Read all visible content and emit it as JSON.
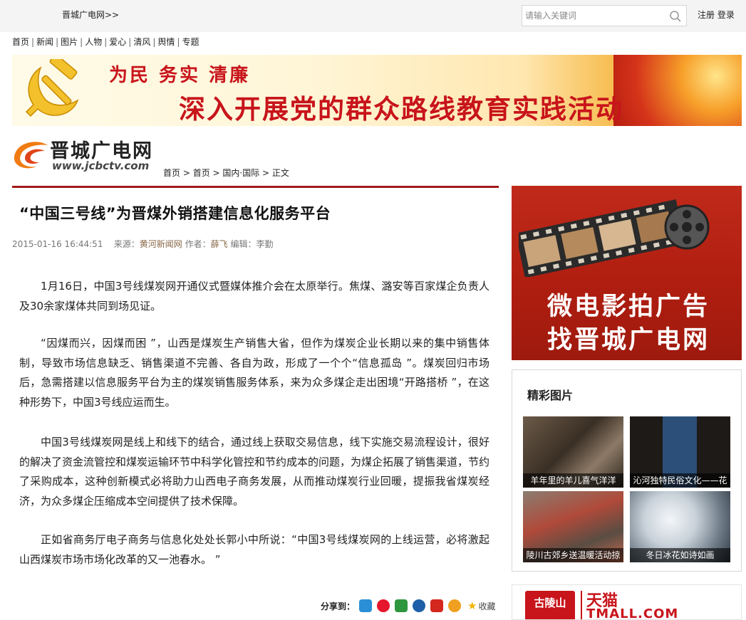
{
  "topbar": {
    "site_link": "晋城广电网>>",
    "search_placeholder": "请输入关键词",
    "register": "注册",
    "login": "登录"
  },
  "nav": {
    "items": [
      "首页",
      "新闻",
      "图片",
      "人物",
      "爱心",
      "清风",
      "舆情",
      "专题"
    ]
  },
  "banner": {
    "line1": "为民 务实 清廉",
    "line2": "深入开展党的群众路线教育实践活动"
  },
  "logo": {
    "name": "晋城广电网",
    "url": "www.jcbctv.com"
  },
  "breadcrumb": [
    "首页",
    "首页",
    "国内·国际",
    "正文"
  ],
  "article": {
    "title": "“中国三号线”为晋煤外销搭建信息化服务平台",
    "meta_datetime": "2015-01-16 16:44:51",
    "meta_source_label": "来源：",
    "meta_source": "黄河新闻网",
    "meta_author_label": "作者：",
    "meta_author": "薛飞",
    "meta_editor_label": "编辑：",
    "meta_editor": "李勤",
    "paragraphs": [
      "1月16日，中国3号线煤炭网开通仪式暨媒体推介会在太原举行。焦煤、潞安等百家煤企负责人及30余家煤体共同到场见证。",
      "“因煤而兴，因煤而困 ”，山西是煤炭生产销售大省，但作为煤炭企业长期以来的集中销售体制，导致市场信息缺乏、销售渠道不完善、各自为政，形成了一个个“信息孤岛 ”。煤炭回归市场后，急需搭建以信息服务平台为主的煤炭销售服务体系，来为众多煤企走出困境“开路搭桥 ”，在这种形势下，中国3号线应运而生。",
      "中国3号线煤炭网是线上和线下的结合，通过线上获取交易信息，线下实施交易流程设计，很好的解决了资金流管控和煤炭运输环节中科学化管控和节约成本的问题，为煤企拓展了销售渠道，节约了采购成本，这种创新模式必将助力山西电子商务发展，从而推动煤炭行业回暖，提振我省煤炭经济，为众多煤企压缩成本空间提供了技术保障。",
      "正如省商务厅电子商务与信息化处处长郭小中所说：“中国3号线煤炭网的上线运营，必将激起山西煤炭市场市场化改革的又一池春水。 ”"
    ]
  },
  "share": {
    "label": "分享到：",
    "fav_label": "收藏",
    "buttons": [
      {
        "icon": "qzone-icon",
        "color": "#2a8fd6"
      },
      {
        "icon": "weibo-icon",
        "color": "#e6162d"
      },
      {
        "icon": "douban-icon",
        "color": "#2e963d"
      },
      {
        "icon": "renren-icon",
        "color": "#1e5fa8"
      },
      {
        "icon": "people-icon",
        "color": "#d4271d"
      },
      {
        "icon": "kaixin-icon",
        "color": "#f0a020"
      }
    ]
  },
  "side_ad": {
    "line1": "微电影拍广告",
    "line2": "找晋城广电网"
  },
  "photo_box": {
    "title": "精彩图片",
    "items": [
      {
        "caption": "羊年里的羊儿喜气洋洋"
      },
      {
        "caption": "沁河独特民俗文化——花"
      },
      {
        "caption": "陵川古郊乡送温暖活动掠"
      },
      {
        "caption": "冬日冰花如诗如画"
      }
    ]
  },
  "bottom_ad": {
    "brand1": "古陵山",
    "brand2": "天猫",
    "brand2_sub": "TMALL.COM"
  },
  "colors": {
    "accent_red": "#a31919",
    "banner_red": "#c8141b"
  }
}
